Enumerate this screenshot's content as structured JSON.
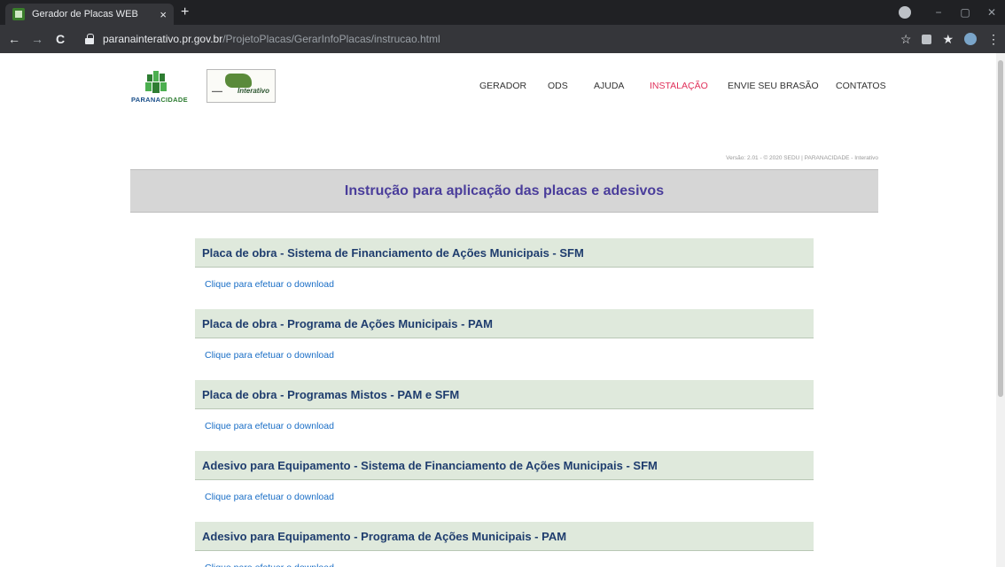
{
  "browser": {
    "tab_title": "Gerador de Placas WEB",
    "tab_close": "×",
    "new_tab": "+",
    "url_host": "paranainterativo.pr.gov.br",
    "url_path": "/ProjetoPlacas/GerarInfoPlacas/instrucao.html",
    "back": "←",
    "forward": "→",
    "reload": "C",
    "star": "☆",
    "extensions": "★",
    "menu": "⋮",
    "minimize": "−",
    "maximize": "▢",
    "close": "✕"
  },
  "logos": {
    "paranacidade_prefix": "PARANA",
    "paranacidade_suffix": "CIDADE",
    "interativo": "Interativo"
  },
  "nav": {
    "items": [
      {
        "label": "GERADOR",
        "active": false
      },
      {
        "label": "ODS",
        "active": false
      },
      {
        "label": "AJUDA",
        "active": false
      },
      {
        "label": "INSTALAÇÃO",
        "active": true
      },
      {
        "label": "ENVIE SEU BRASÃO",
        "active": false
      },
      {
        "label": "CONTATOS",
        "active": false
      }
    ]
  },
  "version_text": "Versão: 2.01 - © 2020 SEDU | PARANACIDADE - Interativo",
  "banner_title": "Instrução para aplicação das placas e adesivos",
  "sections": [
    {
      "title": "Placa de obra - Sistema de Financiamento de Ações Municipais - SFM",
      "link": "Clique para efetuar o download"
    },
    {
      "title": "Placa de obra - Programa de Ações Municipais - PAM",
      "link": "Clique para efetuar o download"
    },
    {
      "title": "Placa de obra - Programas Mistos - PAM e SFM",
      "link": "Clique para efetuar o download"
    },
    {
      "title": "Adesivo para Equipamento - Sistema de Financiamento de Ações Municipais - SFM",
      "link": "Clique para efetuar o download"
    },
    {
      "title": "Adesivo para Equipamento - Programa de Ações Municipais - PAM",
      "link": "Clique para efetuar o download"
    }
  ],
  "colors": {
    "accent_active_nav": "#e0305a",
    "banner_title": "#4a3d9b",
    "section_title": "#1f3d6e",
    "link": "#1a6ec6",
    "section_bg": "#dfe9dc",
    "banner_bg": "#d6d6d6"
  }
}
